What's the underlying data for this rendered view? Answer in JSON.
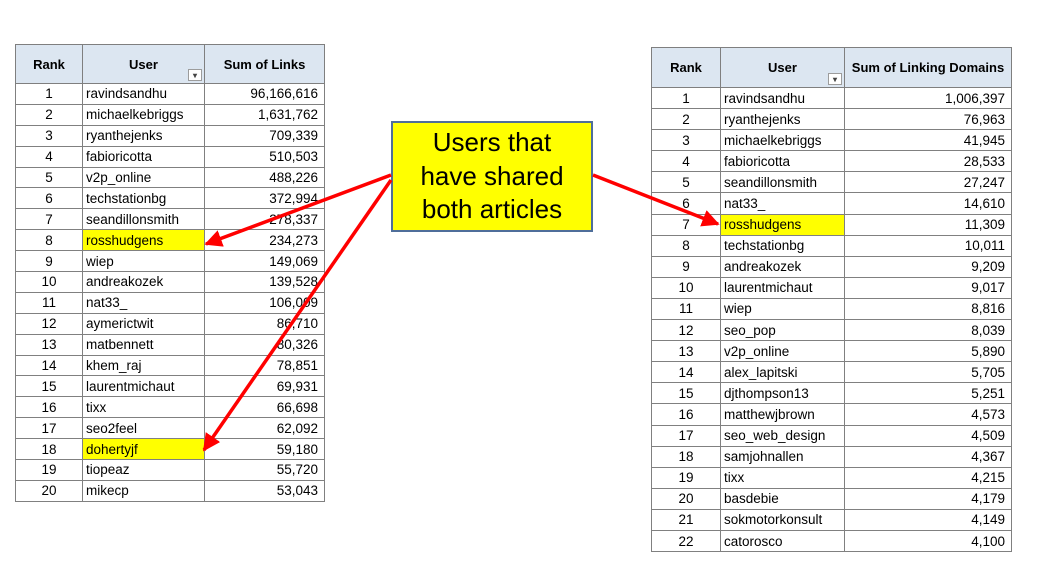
{
  "left_table": {
    "headers": [
      "Rank",
      "User",
      "Sum of Links"
    ],
    "rows": [
      {
        "rank": "1",
        "user": "ravindsandhu",
        "value": "96,166,616",
        "highlight": false
      },
      {
        "rank": "2",
        "user": "michaelkebriggs",
        "value": "1,631,762",
        "highlight": false
      },
      {
        "rank": "3",
        "user": "ryanthejenks",
        "value": "709,339",
        "highlight": false
      },
      {
        "rank": "4",
        "user": "fabioricotta",
        "value": "510,503",
        "highlight": false
      },
      {
        "rank": "5",
        "user": "v2p_online",
        "value": "488,226",
        "highlight": false
      },
      {
        "rank": "6",
        "user": "techstationbg",
        "value": "372,994",
        "highlight": false
      },
      {
        "rank": "7",
        "user": "seandillonsmith",
        "value": "278,337",
        "highlight": false
      },
      {
        "rank": "8",
        "user": "rosshudgens",
        "value": "234,273",
        "highlight": true
      },
      {
        "rank": "9",
        "user": "wiep",
        "value": "149,069",
        "highlight": false
      },
      {
        "rank": "10",
        "user": "andreakozek",
        "value": "139,528",
        "highlight": false
      },
      {
        "rank": "11",
        "user": "nat33_",
        "value": "106,009",
        "highlight": false
      },
      {
        "rank": "12",
        "user": "aymerictwit",
        "value": "86,710",
        "highlight": false
      },
      {
        "rank": "13",
        "user": "matbennett",
        "value": "80,326",
        "highlight": false
      },
      {
        "rank": "14",
        "user": "khem_raj",
        "value": "78,851",
        "highlight": false
      },
      {
        "rank": "15",
        "user": "laurentmichaut",
        "value": "69,931",
        "highlight": false
      },
      {
        "rank": "16",
        "user": "tixx",
        "value": "66,698",
        "highlight": false
      },
      {
        "rank": "17",
        "user": "seo2feel",
        "value": "62,092",
        "highlight": false
      },
      {
        "rank": "18",
        "user": "dohertyjf",
        "value": "59,180",
        "highlight": true
      },
      {
        "rank": "19",
        "user": "tiopeaz",
        "value": "55,720",
        "highlight": false
      },
      {
        "rank": "20",
        "user": "mikecp",
        "value": "53,043",
        "highlight": false
      }
    ]
  },
  "right_table": {
    "headers": [
      "Rank",
      "User",
      "Sum of Linking Domains"
    ],
    "rows": [
      {
        "rank": "1",
        "user": "ravindsandhu",
        "value": "1,006,397",
        "highlight": false
      },
      {
        "rank": "2",
        "user": "ryanthejenks",
        "value": "76,963",
        "highlight": false
      },
      {
        "rank": "3",
        "user": "michaelkebriggs",
        "value": "41,945",
        "highlight": false
      },
      {
        "rank": "4",
        "user": "fabioricotta",
        "value": "28,533",
        "highlight": false
      },
      {
        "rank": "5",
        "user": "seandillonsmith",
        "value": "27,247",
        "highlight": false
      },
      {
        "rank": "6",
        "user": "nat33_",
        "value": "14,610",
        "highlight": false
      },
      {
        "rank": "7",
        "user": "rosshudgens",
        "value": "11,309",
        "highlight": true
      },
      {
        "rank": "8",
        "user": "techstationbg",
        "value": "10,011",
        "highlight": false
      },
      {
        "rank": "9",
        "user": "andreakozek",
        "value": "9,209",
        "highlight": false
      },
      {
        "rank": "10",
        "user": "laurentmichaut",
        "value": "9,017",
        "highlight": false
      },
      {
        "rank": "11",
        "user": "wiep",
        "value": "8,816",
        "highlight": false
      },
      {
        "rank": "12",
        "user": "seo_pop",
        "value": "8,039",
        "highlight": false
      },
      {
        "rank": "13",
        "user": "v2p_online",
        "value": "5,890",
        "highlight": false
      },
      {
        "rank": "14",
        "user": "alex_lapitski",
        "value": "5,705",
        "highlight": false
      },
      {
        "rank": "15",
        "user": "djthompson13",
        "value": "5,251",
        "highlight": false
      },
      {
        "rank": "16",
        "user": "matthewjbrown",
        "value": "4,573",
        "highlight": false
      },
      {
        "rank": "17",
        "user": "seo_web_design",
        "value": "4,509",
        "highlight": false
      },
      {
        "rank": "18",
        "user": "samjohnallen",
        "value": "4,367",
        "highlight": false
      },
      {
        "rank": "19",
        "user": "tixx",
        "value": "4,215",
        "highlight": false
      },
      {
        "rank": "20",
        "user": "basdebie",
        "value": "4,179",
        "highlight": false
      },
      {
        "rank": "21",
        "user": "sokmotorkonsult",
        "value": "4,149",
        "highlight": false
      },
      {
        "rank": "22",
        "user": "catorosco",
        "value": "4,100",
        "highlight": false
      }
    ]
  },
  "callout": {
    "lines": [
      "Users that",
      "have shared",
      "both articles"
    ]
  },
  "colors": {
    "header_fill": "#dce6f1",
    "highlight": "#ffff00",
    "arrow": "#ff0000",
    "callout_border": "#4f6e9a"
  },
  "icons": {
    "filter": "filter-dropdown-icon"
  }
}
